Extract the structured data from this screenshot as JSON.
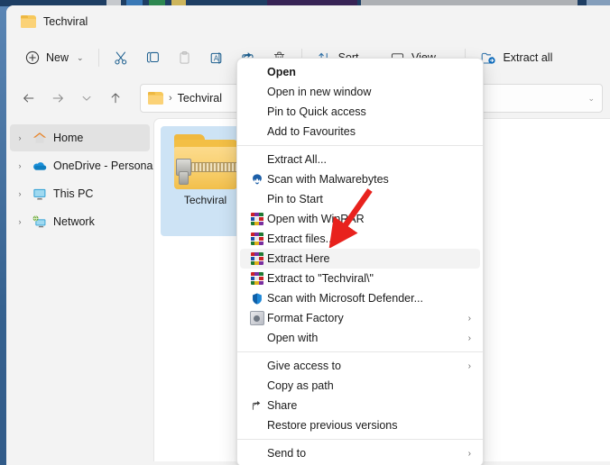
{
  "window": {
    "tab_title": "Techviral",
    "folder_icon": "folder-icon"
  },
  "toolbar": {
    "new_label": "New",
    "new_icon": "plus-circle-icon",
    "cut_icon": "scissors-icon",
    "copy_icon": "copy-icon",
    "paste_icon": "paste-icon",
    "rename_icon": "rename-icon",
    "share_icon": "share-icon",
    "delete_icon": "trash-icon",
    "sort_label": "Sort",
    "sort_icon": "sort-arrows-icon",
    "view_label": "View",
    "view_icon": "monitor-icon",
    "extract_all_label": "Extract all",
    "extract_all_icon": "extract-folder-icon",
    "chevron": "⌄"
  },
  "address": {
    "back_icon": "arrow-left-icon",
    "forward_icon": "arrow-right-icon",
    "recent_icon": "chevron-down-icon",
    "up_icon": "arrow-up-icon",
    "folder_icon": "folder-icon",
    "separator": "›",
    "crumb": "Techviral",
    "caret": "⌄"
  },
  "sidebar": {
    "items": [
      {
        "label": "Home",
        "icon": "home-icon",
        "chevron": "›",
        "selected": true
      },
      {
        "label": "OneDrive - Personal",
        "icon": "cloud-icon",
        "chevron": "›",
        "selected": false
      },
      {
        "label": "This PC",
        "icon": "monitor-icon",
        "chevron": "›",
        "selected": false
      },
      {
        "label": "Network",
        "icon": "network-icon",
        "chevron": "›",
        "selected": false
      }
    ]
  },
  "content": {
    "file": {
      "name": "Techviral",
      "icon": "zipped-folder-icon",
      "selected": true
    }
  },
  "context_menu": {
    "items": [
      {
        "label": "Open",
        "icon": null,
        "bold": true,
        "submenu": false,
        "highlight": false
      },
      {
        "label": "Open in new window",
        "icon": null,
        "bold": false,
        "submenu": false,
        "highlight": false
      },
      {
        "label": "Pin to Quick access",
        "icon": null,
        "bold": false,
        "submenu": false,
        "highlight": false
      },
      {
        "label": "Add to Favourites",
        "icon": null,
        "bold": false,
        "submenu": false,
        "highlight": false
      },
      {
        "separator": true
      },
      {
        "label": "Extract All...",
        "icon": null,
        "bold": false,
        "submenu": false,
        "highlight": false
      },
      {
        "label": "Scan with Malwarebytes",
        "icon": "malwarebytes-icon",
        "bold": false,
        "submenu": false,
        "highlight": false
      },
      {
        "label": "Pin to Start",
        "icon": null,
        "bold": false,
        "submenu": false,
        "highlight": false
      },
      {
        "label": "Open with WinRAR",
        "icon": "winrar-icon",
        "bold": false,
        "submenu": false,
        "highlight": false
      },
      {
        "label": "Extract files...",
        "icon": "winrar-icon",
        "bold": false,
        "submenu": false,
        "highlight": false
      },
      {
        "label": "Extract Here",
        "icon": "winrar-icon",
        "bold": false,
        "submenu": false,
        "highlight": true
      },
      {
        "label": "Extract to \"Techviral\\\"",
        "icon": "winrar-icon",
        "bold": false,
        "submenu": false,
        "highlight": false
      },
      {
        "label": "Scan with Microsoft Defender...",
        "icon": "defender-shield-icon",
        "bold": false,
        "submenu": false,
        "highlight": false
      },
      {
        "label": "Format Factory",
        "icon": "format-factory-icon",
        "bold": false,
        "submenu": true,
        "highlight": false
      },
      {
        "label": "Open with",
        "icon": null,
        "bold": false,
        "submenu": true,
        "highlight": false
      },
      {
        "separator": true
      },
      {
        "label": "Give access to",
        "icon": null,
        "bold": false,
        "submenu": true,
        "highlight": false
      },
      {
        "label": "Copy as path",
        "icon": null,
        "bold": false,
        "submenu": false,
        "highlight": false
      },
      {
        "label": "Share",
        "icon": "share-icon",
        "bold": false,
        "submenu": false,
        "highlight": false
      },
      {
        "label": "Restore previous versions",
        "icon": null,
        "bold": false,
        "submenu": false,
        "highlight": false
      },
      {
        "separator": true
      },
      {
        "label": "Send to",
        "icon": null,
        "bold": false,
        "submenu": true,
        "highlight": false
      }
    ],
    "submenu_glyph": "›"
  },
  "annotation": {
    "arrow_color": "#e8221d",
    "points_to": "Extract files..."
  },
  "colors": {
    "accent": "#0f6cbd",
    "window_bg": "#f3f3f3",
    "content_bg": "#ffffff",
    "selection": "#cde3f5",
    "hover": "#f3f3f3"
  }
}
